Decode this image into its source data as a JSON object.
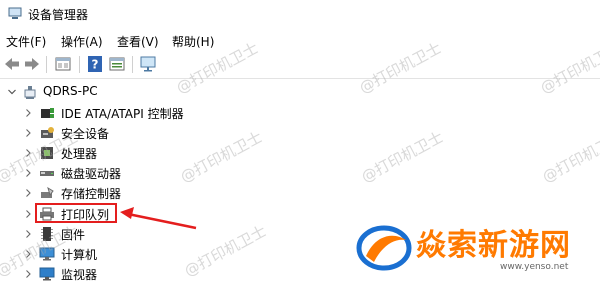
{
  "window": {
    "title": "设备管理器"
  },
  "menu": [
    {
      "label": "文件(F)"
    },
    {
      "label": "操作(A)"
    },
    {
      "label": "查看(V)"
    },
    {
      "label": "帮助(H)"
    }
  ],
  "tree": {
    "root": {
      "label": "QDRS-PC",
      "icon": "computer-icon",
      "expanded": true
    },
    "items": [
      {
        "label": "IDE ATA/ATAPI 控制器",
        "icon": "ide-controller-icon"
      },
      {
        "label": "安全设备",
        "icon": "security-device-icon"
      },
      {
        "label": "处理器",
        "icon": "processor-icon"
      },
      {
        "label": "磁盘驱动器",
        "icon": "disk-drive-icon"
      },
      {
        "label": "存储控制器",
        "icon": "storage-controller-icon"
      },
      {
        "label": "打印队列",
        "icon": "printer-icon",
        "highlighted": true
      },
      {
        "label": "固件",
        "icon": "firmware-icon"
      },
      {
        "label": "计算机",
        "icon": "computer-icon"
      },
      {
        "label": "监视器",
        "icon": "monitor-icon"
      }
    ]
  },
  "watermark": {
    "text": "@打印机卫士"
  },
  "logo": {
    "text": "焱索新游网",
    "url": "www.yenso.net"
  },
  "colors": {
    "annotation_red": "#e41e1e",
    "logo_orange": "#ff7a00",
    "logo_blue": "#1a6fd1"
  }
}
